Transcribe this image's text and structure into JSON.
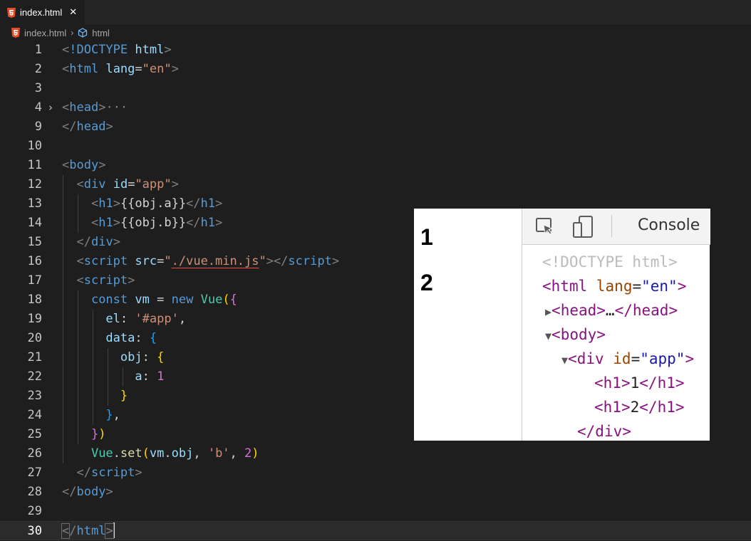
{
  "tab": {
    "label": "index.html",
    "close": "✕"
  },
  "breadcrumb": {
    "file": "index.html",
    "symbol": "html"
  },
  "lines": [
    {
      "n": "1"
    },
    {
      "n": "2"
    },
    {
      "n": "3"
    },
    {
      "n": "4"
    },
    {
      "n": "9"
    },
    {
      "n": "10"
    },
    {
      "n": "11"
    },
    {
      "n": "12"
    },
    {
      "n": "13"
    },
    {
      "n": "14"
    },
    {
      "n": "15"
    },
    {
      "n": "16"
    },
    {
      "n": "17"
    },
    {
      "n": "18"
    },
    {
      "n": "19"
    },
    {
      "n": "20"
    },
    {
      "n": "21"
    },
    {
      "n": "22"
    },
    {
      "n": "23"
    },
    {
      "n": "24"
    },
    {
      "n": "25"
    },
    {
      "n": "26"
    },
    {
      "n": "27"
    },
    {
      "n": "28"
    },
    {
      "n": "29"
    },
    {
      "n": "30"
    }
  ],
  "code": {
    "doctype": "!DOCTYPE",
    "doctype_html": "html",
    "html": "html",
    "lang": "lang",
    "lang_val": "\"en\"",
    "head": "head",
    "ellipsis": "···",
    "body": "body",
    "div": "div",
    "id": "id",
    "app_val": "\"app\"",
    "h1": "h1",
    "obj_a": "{{obj.a}}",
    "obj_b": "{{obj.b}}",
    "script": "script",
    "src": "src",
    "src_val": "./vue.min.js",
    "const": "const",
    "vm": "vm",
    "eq": "=",
    "new": "new",
    "Vue": "Vue",
    "el": "el",
    "el_val": "'#app'",
    "data": "data",
    "obj": "obj",
    "a": "a",
    "one": "1",
    "set": "set",
    "vm_obj": "vm",
    "obj2": "obj",
    "b_val": "'b'",
    "two": "2"
  },
  "preview": {
    "h1_a": "1",
    "h1_b": "2",
    "console_tab": "Console",
    "dom": {
      "doctype": "<!DOCTYPE html>",
      "html_tag": "html",
      "lang_attr": "lang",
      "lang_val": "\"en\"",
      "head_tag": "head",
      "head_ellipsis": "…",
      "body_tag": "body",
      "div_tag": "div",
      "id_attr": "id",
      "id_val": "\"app\"",
      "h1_tag": "h1",
      "h1_text_1": "1",
      "h1_text_2": "2"
    }
  }
}
